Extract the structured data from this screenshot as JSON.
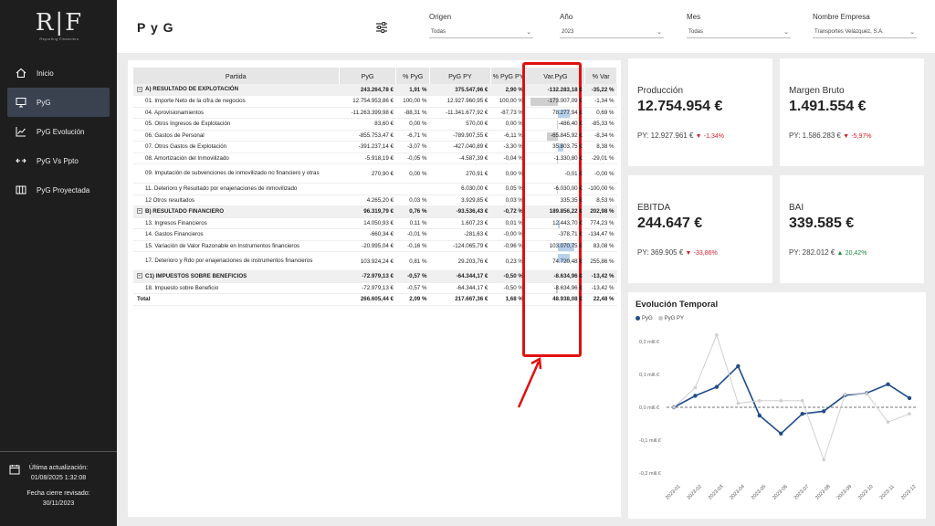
{
  "sidebar": {
    "logo_text": "R|F",
    "logo_sub": "Reporting Financiero",
    "items": [
      {
        "label": "Inicio",
        "icon": "home-icon"
      },
      {
        "label": "PyG",
        "icon": "monitor-icon"
      },
      {
        "label": "PyG Evolución",
        "icon": "line-chart-icon"
      },
      {
        "label": "PyG Vs Ppto",
        "icon": "arrows-icon"
      },
      {
        "label": "PyG Proyectada",
        "icon": "columns-icon"
      }
    ],
    "last_update_label": "Última actualización:",
    "last_update_value": "01/08/2025 1:32:08",
    "close_label": "Fecha cierre revisado:",
    "close_value": "30/11/2023"
  },
  "header": {
    "title": "P y G",
    "slicers": [
      {
        "label": "Origen",
        "value": "Todas"
      },
      {
        "label": "Año",
        "value": "2023"
      },
      {
        "label": "Mes",
        "value": "Todas"
      },
      {
        "label": "Nombre Empresa",
        "value": "Transportes Velázquez, S.A."
      }
    ]
  },
  "table": {
    "headers": [
      "Partida",
      "PyG",
      "% PyG",
      "PyG PY",
      "% PyG PY",
      "Var.PyG",
      "% Var"
    ],
    "rows": [
      {
        "type": "sec",
        "partida": "A) RESULTADO DE EXPLOTACIÓN",
        "pyg": "243.264,78 €",
        "ppyg": "1,91 %",
        "py": "375.547,96 €",
        "ppy": "2,90 %",
        "var": "-132.283,18 €",
        "pvar": "-35,22 %",
        "bar": 0
      },
      {
        "type": "row",
        "partida": "01. Importe Neto de la cifra de negocios",
        "pyg": "12.754.953,86 €",
        "ppyg": "100,00 %",
        "py": "12.927.960,95 €",
        "ppy": "100,00 %",
        "var": "-173.007,09 €",
        "pvar": "-1,34 %",
        "bar": -1.0
      },
      {
        "type": "row",
        "partida": "04. Aprovisionamientos",
        "pyg": "-11.263.399,98 €",
        "ppyg": "-88,31 %",
        "py": "-11.341.677,92 €",
        "ppy": "-87,73 %",
        "var": "78.277,94 €",
        "pvar": "0,69 %",
        "bar": 0.45
      },
      {
        "type": "row",
        "partida": "05. Otros Ingresos de Explotación",
        "pyg": "83,60 €",
        "ppyg": "0,00 %",
        "py": "570,00 €",
        "ppy": "0,00 %",
        "var": "-486,40 €",
        "pvar": "-85,33 %",
        "bar": -0.01
      },
      {
        "type": "row",
        "partida": "06. Gastos de Personal",
        "pyg": "-855.753,47 €",
        "ppyg": "-6,71 %",
        "py": "-789.907,55 €",
        "ppy": "-6,11 %",
        "var": "-65.845,92 €",
        "pvar": "-8,34 %",
        "bar": -0.38
      },
      {
        "type": "row",
        "partida": "07. Otros Gastos de Explotación",
        "pyg": "-391.237,14 €",
        "ppyg": "-3,07 %",
        "py": "-427.040,89 €",
        "ppy": "-3,30 %",
        "var": "35.803,75 €",
        "pvar": "8,38 %",
        "bar": 0.21
      },
      {
        "type": "row",
        "partida": "08. Amortización del Inmovilizado",
        "pyg": "-5.918,19 €",
        "ppyg": "-0,05 %",
        "py": "-4.587,39 €",
        "ppy": "-0,04 %",
        "var": "-1.330,80 €",
        "pvar": "-29,01 %",
        "bar": -0.01
      },
      {
        "type": "tall",
        "partida": "09. Imputación de subvenciones de inmovilizado no financiero y otras",
        "pyg": "270,90 €",
        "ppyg": "0,00 %",
        "py": "270,91 €",
        "ppy": "0,00 %",
        "var": "-0,01 €",
        "pvar": "-0,00 %",
        "bar": 0
      },
      {
        "type": "row",
        "partida": "11. Deterioro y Resultado por enajenaciones de inmovilizado",
        "pyg": "",
        "ppyg": "",
        "py": "6.030,00 €",
        "ppy": "0,05 %",
        "var": "-6.030,00 €",
        "pvar": "-100,00 %",
        "bar": -0.03
      },
      {
        "type": "row",
        "partida": "12 Otros resultados",
        "pyg": "4.265,20 €",
        "ppyg": "0,03 %",
        "py": "3.929,85 €",
        "ppy": "0,03 %",
        "var": "335,35 €",
        "pvar": "8,53 %",
        "bar": 0
      },
      {
        "type": "sec",
        "partida": "B) RESULTADO FINANCIERO",
        "pyg": "96.319,79 €",
        "ppyg": "0,76 %",
        "py": "-93.536,43 €",
        "ppy": "-0,72 %",
        "var": "189.856,22 €",
        "pvar": "202,98 %",
        "bar": 0
      },
      {
        "type": "row",
        "partida": "13. Ingresos Financieros",
        "pyg": "14.050,93 €",
        "ppyg": "0,11 %",
        "py": "1.607,23 €",
        "ppy": "0,01 %",
        "var": "12.443,70 €",
        "pvar": "774,23 %",
        "bar": 0.07
      },
      {
        "type": "row",
        "partida": "14. Gastos Financieros",
        "pyg": "-660,34 €",
        "ppyg": "-0,01 %",
        "py": "-281,63 €",
        "ppy": "-0,00 %",
        "var": "-378,71 €",
        "pvar": "-134,47 %",
        "bar": 0
      },
      {
        "type": "row",
        "partida": "15. Variación de Valor Razonable en Instrumentos financieros",
        "pyg": "-20.995,04 €",
        "ppyg": "-0,16 %",
        "py": "-124.065,79 €",
        "ppy": "-0,96 %",
        "var": "103.070,75 €",
        "pvar": "83,08 %",
        "bar": 0.6
      },
      {
        "type": "tall",
        "partida": "17. Deterioro y Rdo por enajenaciones de instrumentos financieros",
        "pyg": "103.924,24 €",
        "ppyg": "0,81 %",
        "py": "29.203,76 €",
        "ppy": "0,23 %",
        "var": "74.720,48 €",
        "pvar": "255,86 %",
        "bar": 0.43
      },
      {
        "type": "sec",
        "partida": "C1) IMPUESTOS SOBRE BENEFICIOS",
        "pyg": "-72.979,13 €",
        "ppyg": "-0,57 %",
        "py": "-64.344,17 €",
        "ppy": "-0,50 %",
        "var": "-8.634,96 €",
        "pvar": "-13,42 %",
        "bar": 0
      },
      {
        "type": "row",
        "partida": "18. Impuesto sobre Beneficio",
        "pyg": "-72.979,13 €",
        "ppyg": "-0,57 %",
        "py": "-64.344,17 €",
        "ppy": "-0,50 %",
        "var": "-8.634,96 €",
        "pvar": "-13,42 %",
        "bar": -0.05
      },
      {
        "type": "tot",
        "partida": "Total",
        "pyg": "266.605,44 €",
        "ppyg": "2,09 %",
        "py": "217.667,36 €",
        "ppy": "1,68 %",
        "var": "48.938,08 €",
        "pvar": "22,48 %",
        "bar": 0
      }
    ]
  },
  "kpis": [
    {
      "title": "Producción",
      "value": "12.754.954 €",
      "py_label": "PY: 12.927.961 €",
      "delta": "-1,34%",
      "dir": "down"
    },
    {
      "title": "Margen Bruto",
      "value": "1.491.554 €",
      "py_label": "PY: 1.586.283 €",
      "delta": "-5,97%",
      "dir": "down"
    },
    {
      "title": "EBITDA",
      "value": "244.647 €",
      "py_label": "PY: 369.905 €",
      "delta": "-33,86%",
      "dir": "down"
    },
    {
      "title": "BAI",
      "value": "339.585 €",
      "py_label": "PY: 282.012 €",
      "delta": "20,42%",
      "dir": "up"
    }
  ],
  "chart": {
    "title": "Evolución Temporal",
    "legend": [
      {
        "name": "PyG",
        "color": "#1f4e8a"
      },
      {
        "name": "PyG PY",
        "color": "#c8c8c8"
      }
    ]
  },
  "chart_data": {
    "type": "line",
    "x": [
      "2023-01",
      "2023-02",
      "2023-03",
      "2023-04",
      "2023-05",
      "2023-06",
      "2023-07",
      "2023-08",
      "2023-09",
      "2023-10",
      "2023-11",
      "2023-12"
    ],
    "series": [
      {
        "name": "PyG",
        "values": [
          0.0,
          0.035,
          0.062,
          0.125,
          -0.025,
          -0.08,
          -0.02,
          -0.012,
          0.037,
          0.043,
          0.07,
          0.028
        ]
      },
      {
        "name": "PyG PY",
        "values": [
          0.0,
          0.06,
          0.22,
          0.012,
          0.02,
          0.02,
          0.02,
          -0.16,
          0.04,
          0.042,
          -0.045,
          -0.02
        ]
      }
    ],
    "yticks": [
      "0,2 mill.€",
      "0,1 mill.€",
      "0,0 mill.€",
      "-0,1 mill.€",
      "-0,2 mill.€"
    ],
    "ylim": [
      -0.2,
      0.2
    ]
  }
}
